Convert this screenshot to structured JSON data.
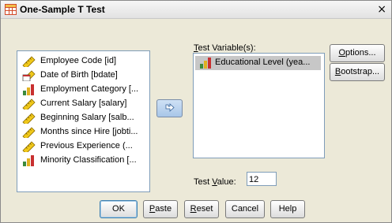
{
  "window": {
    "title": "One-Sample T Test",
    "close_glyph": "×"
  },
  "source_variables": [
    {
      "label": "Employee Code [id]",
      "icon": "ruler-scale-icon"
    },
    {
      "label": "Date of Birth [bdate]",
      "icon": "calendar-scale-icon"
    },
    {
      "label": "Employment Category [...",
      "icon": "bar-chart-ordinal-icon"
    },
    {
      "label": "Current Salary [salary]",
      "icon": "ruler-scale-icon"
    },
    {
      "label": "Beginning Salary [salb...",
      "icon": "ruler-scale-icon"
    },
    {
      "label": "Months since Hire [jobti...",
      "icon": "ruler-scale-icon"
    },
    {
      "label": "Previous Experience (...",
      "icon": "ruler-scale-icon"
    },
    {
      "label": "Minority Classification [...",
      "icon": "bar-chart-ordinal-icon"
    }
  ],
  "move_button": {
    "icon": "arrow-right-icon"
  },
  "test_variables": {
    "label_prefix": "T",
    "label_rest": "est Variable(s):",
    "items": [
      {
        "label": "Educational Level (yea...",
        "icon": "bar-chart-ordinal-icon"
      }
    ]
  },
  "side_buttons": {
    "options": {
      "mnemonic": "O",
      "rest": "ptions..."
    },
    "bootstrap": {
      "mnemonic": "B",
      "rest": "ootstrap..."
    }
  },
  "test_value": {
    "label_a": "Test ",
    "mnemonic": "V",
    "label_b": "alue:",
    "value": "12"
  },
  "bottom_buttons": {
    "ok": "OK",
    "paste": {
      "mnemonic": "P",
      "rest": "aste"
    },
    "reset": {
      "mnemonic": "R",
      "rest": "eset"
    },
    "cancel": "Cancel",
    "help": "Help"
  },
  "colors": {
    "accent_blue": "#3c7fb1",
    "selection_gray": "#c7c7c7"
  }
}
